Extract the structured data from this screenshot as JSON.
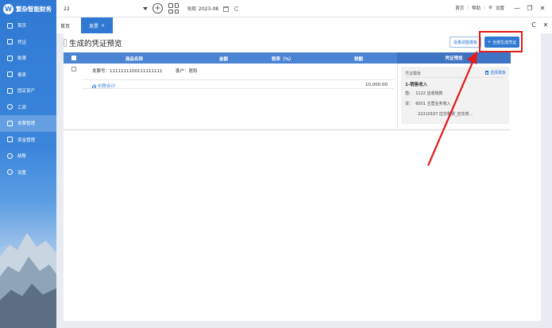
{
  "app": {
    "name": "繁杂智能财务",
    "logo_glyph": "W"
  },
  "sidebar": {
    "items": [
      {
        "label": "首页",
        "icon": "home-icon"
      },
      {
        "label": "凭证",
        "icon": "voucher-icon"
      },
      {
        "label": "账簿",
        "icon": "ledger-icon"
      },
      {
        "label": "报表",
        "icon": "report-icon"
      },
      {
        "label": "固定资产",
        "icon": "asset-icon"
      },
      {
        "label": "工资",
        "icon": "salary-icon"
      },
      {
        "label": "发票管理",
        "icon": "invoice-icon",
        "active": true
      },
      {
        "label": "资金管理",
        "icon": "fund-icon"
      },
      {
        "label": "结账",
        "icon": "close-account-icon"
      },
      {
        "label": "设置",
        "icon": "settings-icon"
      }
    ]
  },
  "topbar": {
    "account_value": "22",
    "period_label": "账期",
    "period_value": "2023-08",
    "links": [
      "首页",
      "帮助",
      "设置"
    ],
    "window_controls": [
      "—",
      "❐",
      "✕"
    ]
  },
  "tabs": {
    "home": "首页",
    "active": "发票",
    "active_close": "×",
    "right_icons": [
      "C",
      "✕"
    ]
  },
  "page": {
    "title": "生成的凭证预览",
    "btn_adjust": "批量调整模板",
    "btn_generate_icon": "+",
    "btn_generate": "全部生成凭证"
  },
  "table": {
    "headers": [
      "商品名称",
      "金额",
      "税率（%）",
      "税额"
    ],
    "preview_header": "凭证预览",
    "invoice_no_label": "发票号：",
    "invoice_no": "1111111100111111111",
    "customer_label": "客户：",
    "customer": "昆阳",
    "sum_label": "价税合计",
    "sum_amount": "10,000.00"
  },
  "preview": {
    "template_label": "凭证模板",
    "select_template": "选择模板",
    "summary": "1-销售收入",
    "debit_label": "借：",
    "debit": "1122 应收账款",
    "credit_label": "贷：",
    "credit_1": "6001 主营业务收入",
    "credit_2": "22210107 应交税费_应交增..."
  },
  "colors": {
    "primary": "#2f79d4",
    "table_header": "#4a84d3",
    "highlight": "#e21b1b"
  }
}
